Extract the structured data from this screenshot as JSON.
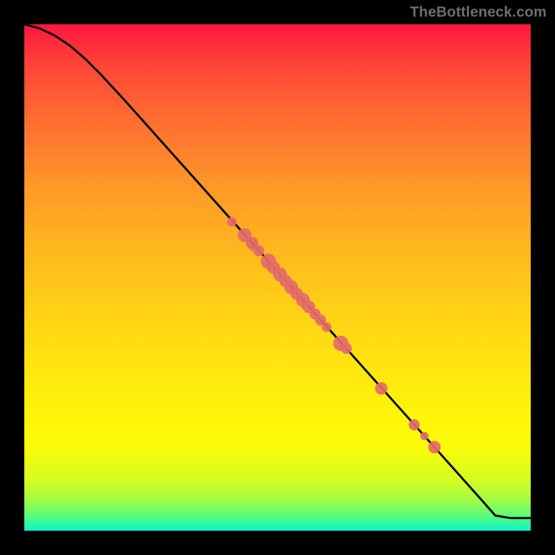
{
  "watermark": "TheBottleneck.com",
  "chart_data": {
    "type": "line",
    "title": "",
    "xlabel": "",
    "ylabel": "",
    "xlim": [
      0,
      100
    ],
    "ylim": [
      0,
      100
    ],
    "curve": [
      {
        "x": 0,
        "y": 100.0
      },
      {
        "x": 3,
        "y": 99.2
      },
      {
        "x": 6,
        "y": 97.8
      },
      {
        "x": 9,
        "y": 95.8
      },
      {
        "x": 12,
        "y": 93.2
      },
      {
        "x": 15,
        "y": 90.2
      },
      {
        "x": 20,
        "y": 84.8
      },
      {
        "x": 30,
        "y": 73.6
      },
      {
        "x": 40,
        "y": 62.4
      },
      {
        "x": 50,
        "y": 51.2
      },
      {
        "x": 60,
        "y": 40.0
      },
      {
        "x": 70,
        "y": 28.8
      },
      {
        "x": 80,
        "y": 17.6
      },
      {
        "x": 90,
        "y": 6.4
      },
      {
        "x": 93,
        "y": 3.0
      },
      {
        "x": 96,
        "y": 2.5
      },
      {
        "x": 100,
        "y": 2.5
      }
    ],
    "points": [
      {
        "x": 41.0,
        "y": 61.0,
        "r": 7
      },
      {
        "x": 43.5,
        "y": 58.4,
        "r": 10
      },
      {
        "x": 45.0,
        "y": 56.8,
        "r": 9
      },
      {
        "x": 46.3,
        "y": 55.3,
        "r": 8
      },
      {
        "x": 48.2,
        "y": 53.2,
        "r": 11
      },
      {
        "x": 49.3,
        "y": 51.9,
        "r": 9
      },
      {
        "x": 50.5,
        "y": 50.6,
        "r": 10
      },
      {
        "x": 51.6,
        "y": 49.3,
        "r": 9
      },
      {
        "x": 52.7,
        "y": 48.1,
        "r": 10
      },
      {
        "x": 53.8,
        "y": 46.8,
        "r": 9
      },
      {
        "x": 55.0,
        "y": 45.6,
        "r": 10
      },
      {
        "x": 56.2,
        "y": 44.2,
        "r": 9
      },
      {
        "x": 57.4,
        "y": 42.8,
        "r": 8
      },
      {
        "x": 58.5,
        "y": 41.6,
        "r": 8
      },
      {
        "x": 59.7,
        "y": 40.2,
        "r": 7
      },
      {
        "x": 62.5,
        "y": 37.0,
        "r": 11
      },
      {
        "x": 63.6,
        "y": 36.0,
        "r": 8
      },
      {
        "x": 70.5,
        "y": 28.1,
        "r": 9
      },
      {
        "x": 77.0,
        "y": 20.9,
        "r": 8
      },
      {
        "x": 79.0,
        "y": 18.7,
        "r": 6
      },
      {
        "x": 81.0,
        "y": 16.5,
        "r": 9
      }
    ],
    "drips": [
      {
        "x": 45.0,
        "len": 12
      },
      {
        "x": 48.2,
        "len": 14
      },
      {
        "x": 50.5,
        "len": 10
      },
      {
        "x": 52.7,
        "len": 11
      },
      {
        "x": 55.0,
        "len": 13
      },
      {
        "x": 62.5,
        "len": 9
      }
    ],
    "colors": {
      "curve": "#000000",
      "point_fill": "#e46a6a",
      "point_alpha": 0.92
    }
  }
}
